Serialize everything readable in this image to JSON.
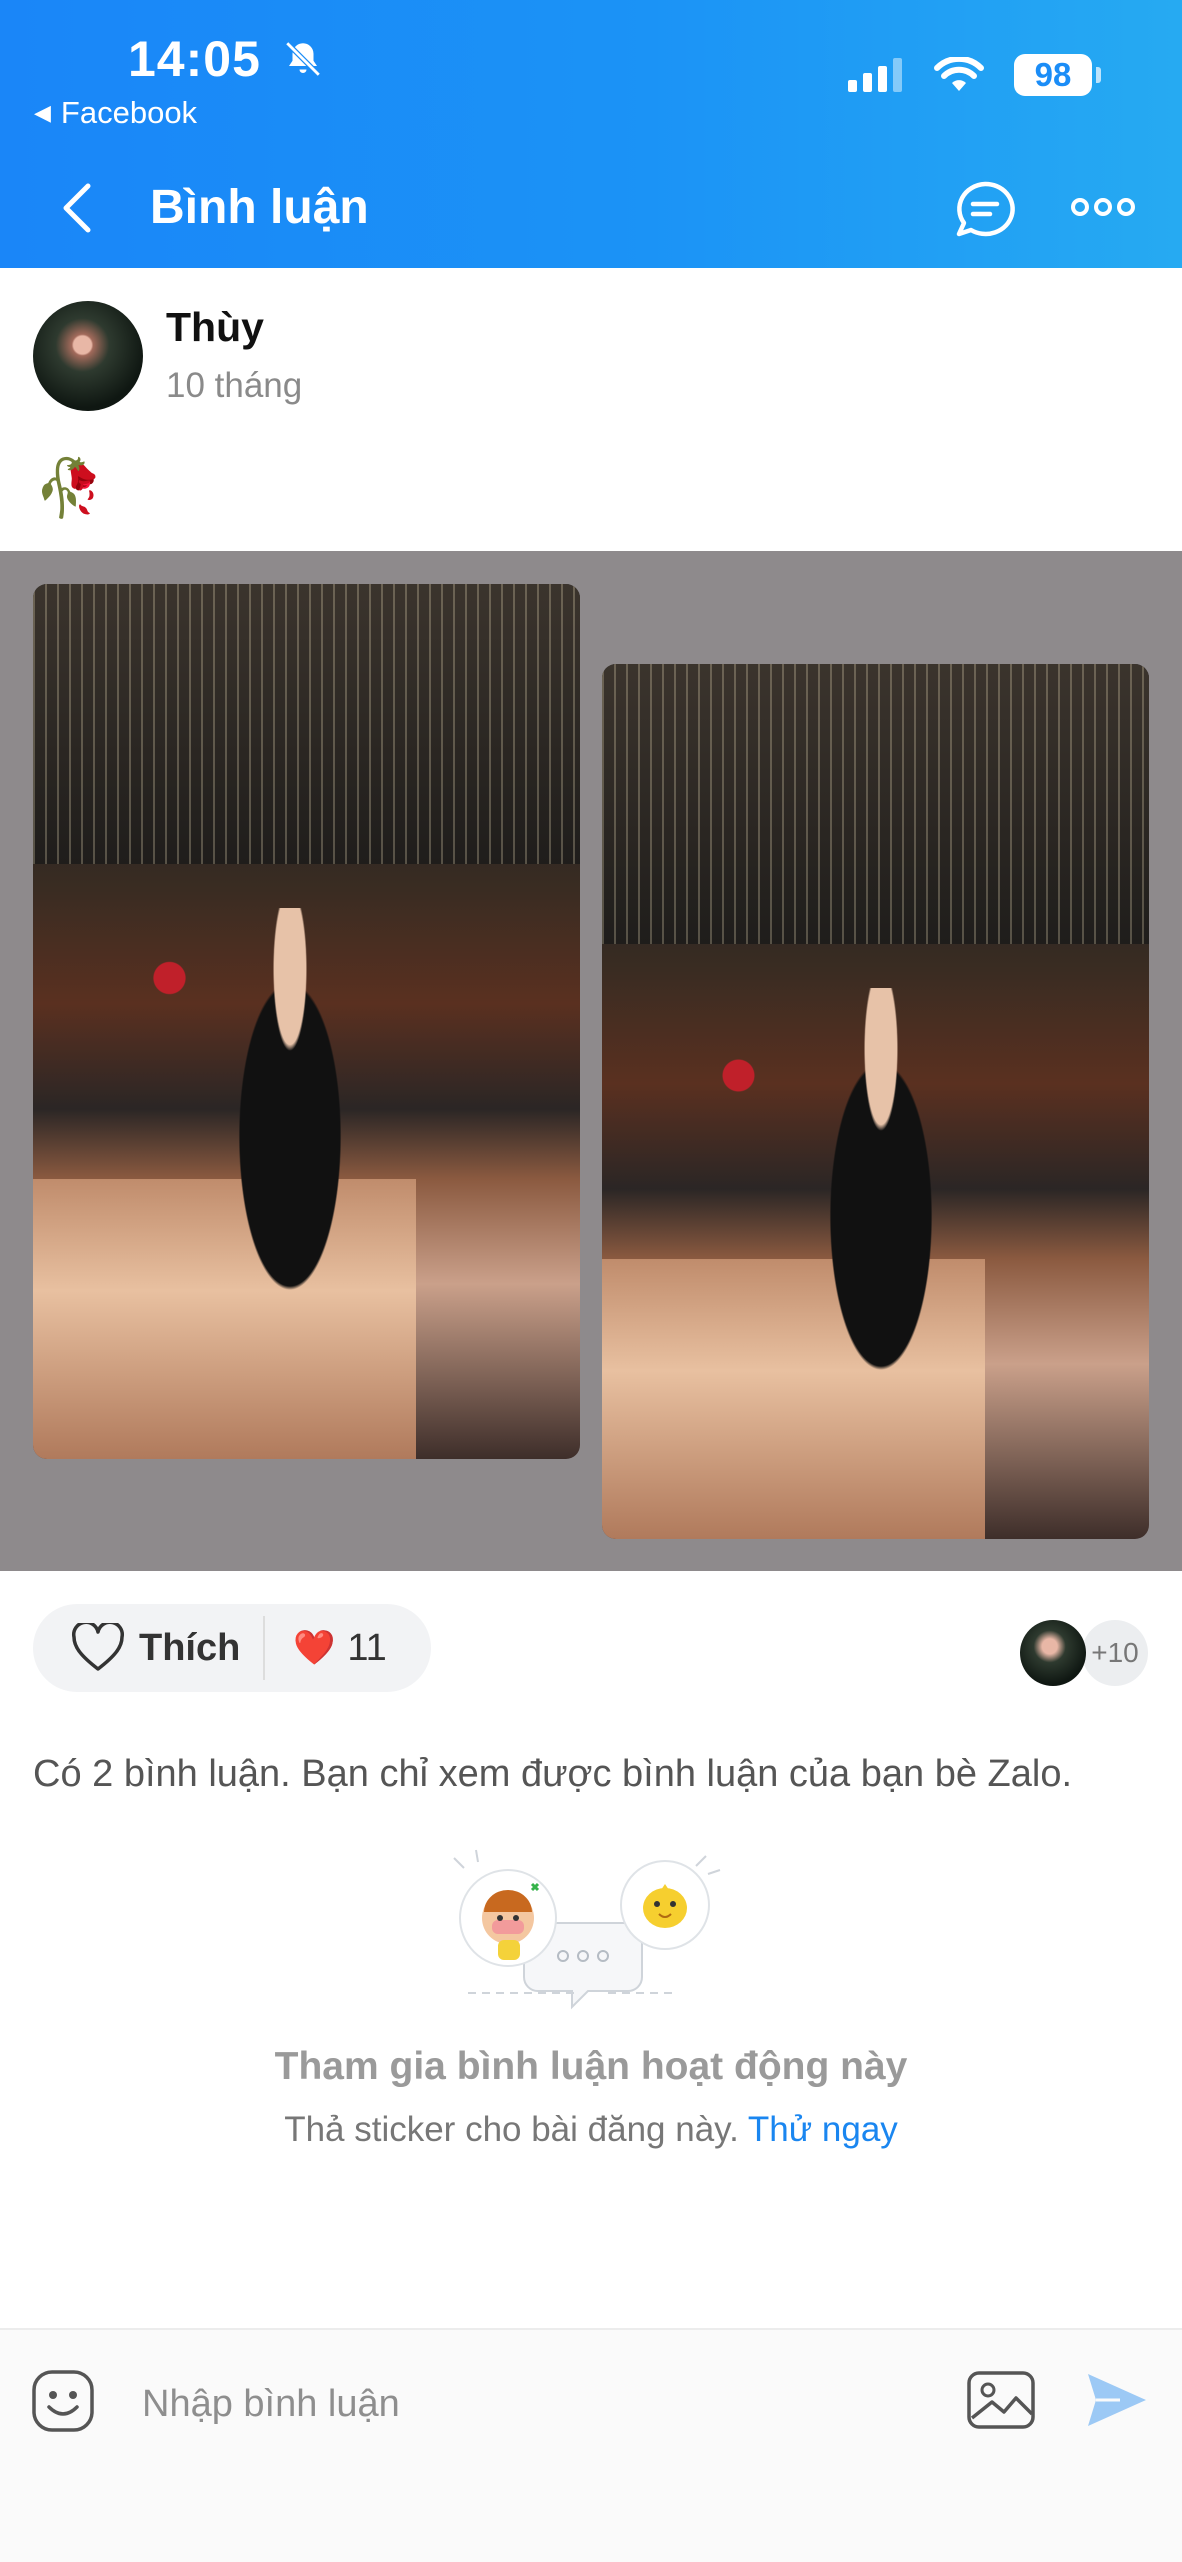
{
  "status_bar": {
    "time": "14:05",
    "back_app": "Facebook",
    "battery": "98"
  },
  "nav": {
    "title": "Bình luận"
  },
  "post": {
    "author": "Thùy",
    "time": "10 tháng",
    "content_emoji": "🥀"
  },
  "reactions": {
    "like_label": "Thích",
    "heart_emoji": "❤️",
    "count": "11",
    "more_likers": "+10"
  },
  "comments": {
    "info": "Có 2 bình luận. Bạn chỉ xem được bình luận của bạn bè Zalo."
  },
  "empty_state": {
    "title": "Tham gia bình luận hoạt động này",
    "subtitle": "Thả sticker cho bài đăng này.",
    "action": "Thử ngay"
  },
  "composer": {
    "placeholder": "Nhập bình luận"
  },
  "colors": {
    "header_start": "#1a86f8",
    "header_end": "#26aaf2",
    "link": "#1a86f0"
  }
}
